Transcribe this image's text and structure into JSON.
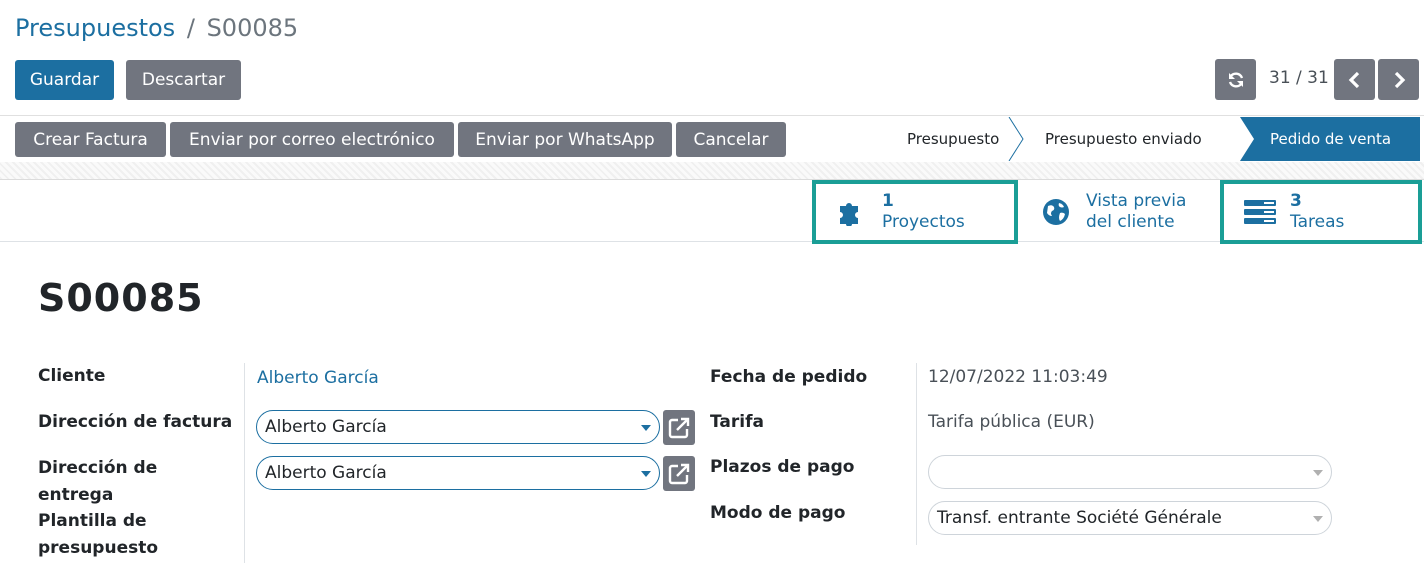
{
  "breadcrumb": {
    "parent": "Presupuestos",
    "separator": "/",
    "current": "S00085"
  },
  "toolbar": {
    "save_label": "Guardar",
    "discard_label": "Descartar"
  },
  "pager": {
    "value": "31 / 31"
  },
  "actions": [
    {
      "label": "Crear Factura"
    },
    {
      "label": "Enviar por correo electrónico"
    },
    {
      "label": "Enviar por WhatsApp"
    },
    {
      "label": "Cancelar"
    }
  ],
  "statusbar": {
    "steps": [
      {
        "label": "Presupuesto"
      },
      {
        "label": "Presupuesto enviado"
      },
      {
        "label": "Pedido de venta",
        "active": true
      }
    ]
  },
  "smart_buttons": {
    "projects": {
      "count": "1",
      "label": "Proyectos",
      "icon": "puzzle-icon"
    },
    "preview": {
      "line1": "Vista previa",
      "line2": "del cliente",
      "icon": "globe-icon"
    },
    "tasks": {
      "count": "3",
      "label": "Tareas",
      "icon": "tasks-icon"
    }
  },
  "record": {
    "name": "S00085"
  },
  "fields_left": {
    "customer": {
      "label": "Cliente",
      "value": "Alberto García"
    },
    "invoice_address": {
      "label": "Dirección de factura",
      "value": "Alberto García"
    },
    "delivery_address": {
      "label_line1": "Dirección de",
      "label_line2": "entrega",
      "value": "Alberto García"
    },
    "quote_template": {
      "label_line1": "Plantilla de",
      "label_line2": "presupuesto"
    }
  },
  "fields_right": {
    "order_date": {
      "label": "Fecha de pedido",
      "value": "12/07/2022 11:03:49"
    },
    "pricelist": {
      "label": "Tarifa",
      "value": "Tarifa pública (EUR)"
    },
    "payment_terms": {
      "label": "Plazos de pago",
      "value": ""
    },
    "payment_mode": {
      "label": "Modo de pago",
      "value": "Transf. entrante Société Générale"
    }
  },
  "colors": {
    "primary": "#1c6fa1",
    "secondary": "#71757f",
    "highlight": "#1a9e96"
  }
}
